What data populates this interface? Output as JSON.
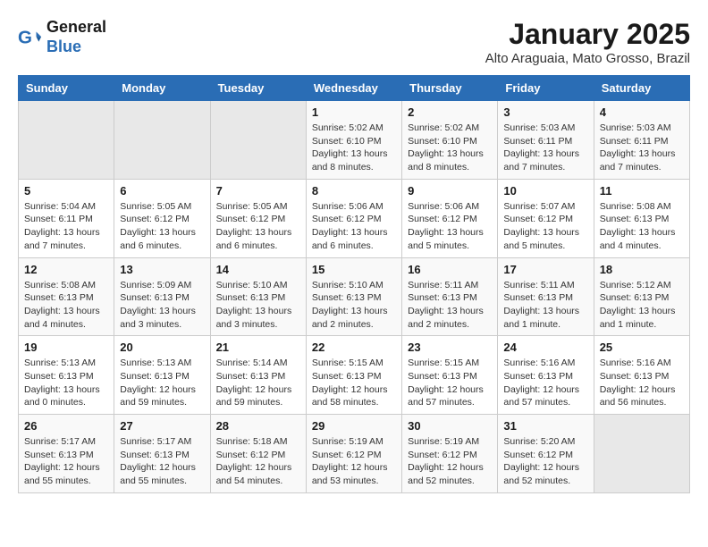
{
  "header": {
    "logo_line1": "General",
    "logo_line2": "Blue",
    "title": "January 2025",
    "subtitle": "Alto Araguaia, Mato Grosso, Brazil"
  },
  "weekdays": [
    "Sunday",
    "Monday",
    "Tuesday",
    "Wednesday",
    "Thursday",
    "Friday",
    "Saturday"
  ],
  "weeks": [
    [
      {
        "day": "",
        "info": ""
      },
      {
        "day": "",
        "info": ""
      },
      {
        "day": "",
        "info": ""
      },
      {
        "day": "1",
        "info": "Sunrise: 5:02 AM\nSunset: 6:10 PM\nDaylight: 13 hours and 8 minutes."
      },
      {
        "day": "2",
        "info": "Sunrise: 5:02 AM\nSunset: 6:10 PM\nDaylight: 13 hours and 8 minutes."
      },
      {
        "day": "3",
        "info": "Sunrise: 5:03 AM\nSunset: 6:11 PM\nDaylight: 13 hours and 7 minutes."
      },
      {
        "day": "4",
        "info": "Sunrise: 5:03 AM\nSunset: 6:11 PM\nDaylight: 13 hours and 7 minutes."
      }
    ],
    [
      {
        "day": "5",
        "info": "Sunrise: 5:04 AM\nSunset: 6:11 PM\nDaylight: 13 hours and 7 minutes."
      },
      {
        "day": "6",
        "info": "Sunrise: 5:05 AM\nSunset: 6:12 PM\nDaylight: 13 hours and 6 minutes."
      },
      {
        "day": "7",
        "info": "Sunrise: 5:05 AM\nSunset: 6:12 PM\nDaylight: 13 hours and 6 minutes."
      },
      {
        "day": "8",
        "info": "Sunrise: 5:06 AM\nSunset: 6:12 PM\nDaylight: 13 hours and 6 minutes."
      },
      {
        "day": "9",
        "info": "Sunrise: 5:06 AM\nSunset: 6:12 PM\nDaylight: 13 hours and 5 minutes."
      },
      {
        "day": "10",
        "info": "Sunrise: 5:07 AM\nSunset: 6:12 PM\nDaylight: 13 hours and 5 minutes."
      },
      {
        "day": "11",
        "info": "Sunrise: 5:08 AM\nSunset: 6:13 PM\nDaylight: 13 hours and 4 minutes."
      }
    ],
    [
      {
        "day": "12",
        "info": "Sunrise: 5:08 AM\nSunset: 6:13 PM\nDaylight: 13 hours and 4 minutes."
      },
      {
        "day": "13",
        "info": "Sunrise: 5:09 AM\nSunset: 6:13 PM\nDaylight: 13 hours and 3 minutes."
      },
      {
        "day": "14",
        "info": "Sunrise: 5:10 AM\nSunset: 6:13 PM\nDaylight: 13 hours and 3 minutes."
      },
      {
        "day": "15",
        "info": "Sunrise: 5:10 AM\nSunset: 6:13 PM\nDaylight: 13 hours and 2 minutes."
      },
      {
        "day": "16",
        "info": "Sunrise: 5:11 AM\nSunset: 6:13 PM\nDaylight: 13 hours and 2 minutes."
      },
      {
        "day": "17",
        "info": "Sunrise: 5:11 AM\nSunset: 6:13 PM\nDaylight: 13 hours and 1 minute."
      },
      {
        "day": "18",
        "info": "Sunrise: 5:12 AM\nSunset: 6:13 PM\nDaylight: 13 hours and 1 minute."
      }
    ],
    [
      {
        "day": "19",
        "info": "Sunrise: 5:13 AM\nSunset: 6:13 PM\nDaylight: 13 hours and 0 minutes."
      },
      {
        "day": "20",
        "info": "Sunrise: 5:13 AM\nSunset: 6:13 PM\nDaylight: 12 hours and 59 minutes."
      },
      {
        "day": "21",
        "info": "Sunrise: 5:14 AM\nSunset: 6:13 PM\nDaylight: 12 hours and 59 minutes."
      },
      {
        "day": "22",
        "info": "Sunrise: 5:15 AM\nSunset: 6:13 PM\nDaylight: 12 hours and 58 minutes."
      },
      {
        "day": "23",
        "info": "Sunrise: 5:15 AM\nSunset: 6:13 PM\nDaylight: 12 hours and 57 minutes."
      },
      {
        "day": "24",
        "info": "Sunrise: 5:16 AM\nSunset: 6:13 PM\nDaylight: 12 hours and 57 minutes."
      },
      {
        "day": "25",
        "info": "Sunrise: 5:16 AM\nSunset: 6:13 PM\nDaylight: 12 hours and 56 minutes."
      }
    ],
    [
      {
        "day": "26",
        "info": "Sunrise: 5:17 AM\nSunset: 6:13 PM\nDaylight: 12 hours and 55 minutes."
      },
      {
        "day": "27",
        "info": "Sunrise: 5:17 AM\nSunset: 6:13 PM\nDaylight: 12 hours and 55 minutes."
      },
      {
        "day": "28",
        "info": "Sunrise: 5:18 AM\nSunset: 6:12 PM\nDaylight: 12 hours and 54 minutes."
      },
      {
        "day": "29",
        "info": "Sunrise: 5:19 AM\nSunset: 6:12 PM\nDaylight: 12 hours and 53 minutes."
      },
      {
        "day": "30",
        "info": "Sunrise: 5:19 AM\nSunset: 6:12 PM\nDaylight: 12 hours and 52 minutes."
      },
      {
        "day": "31",
        "info": "Sunrise: 5:20 AM\nSunset: 6:12 PM\nDaylight: 12 hours and 52 minutes."
      },
      {
        "day": "",
        "info": ""
      }
    ]
  ]
}
